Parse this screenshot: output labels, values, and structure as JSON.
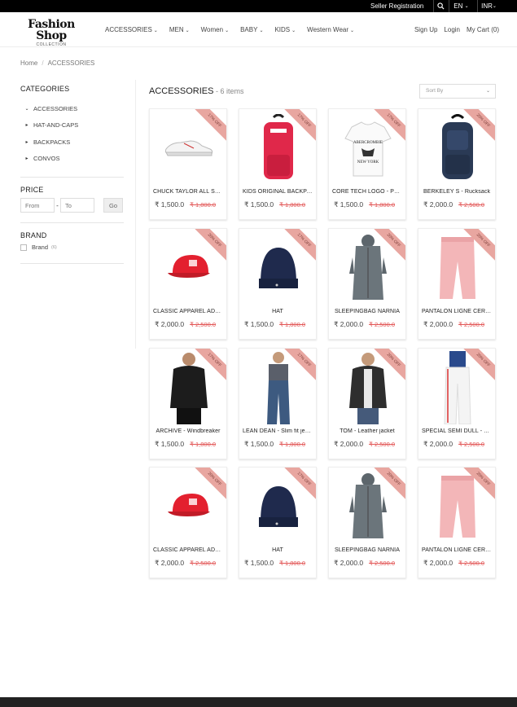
{
  "topbar": {
    "seller": "Seller Registration",
    "lang": "EN",
    "currency": "INR"
  },
  "logo": {
    "line1": "Fashion Shop",
    "line2": "COLLECTION"
  },
  "nav": [
    {
      "label": "ACCESSORIES"
    },
    {
      "label": "MEN"
    },
    {
      "label": "Women"
    },
    {
      "label": "BABY"
    },
    {
      "label": "KIDS"
    },
    {
      "label": "Western Wear"
    }
  ],
  "header_right": {
    "signup": "Sign Up",
    "login": "Login",
    "cart": "My Cart (0)"
  },
  "breadcrumb": {
    "home": "Home",
    "sep": "/",
    "current": "ACCESSORIES"
  },
  "sidebar": {
    "categories_title": "CATEGORIES",
    "categories": [
      {
        "label": "ACCESSORIES",
        "arrow": "⌄"
      },
      {
        "label": "HAT-AND-CAPS",
        "arrow": "▸"
      },
      {
        "label": "BACKPACKS",
        "arrow": "▸"
      },
      {
        "label": "CONVOS",
        "arrow": "▸"
      }
    ],
    "price_title": "PRICE",
    "price_from": "From",
    "price_to": "To",
    "go": "Go",
    "brand_title": "BRAND",
    "brand_label": "Brand",
    "brand_count": "(6)"
  },
  "products_title": "ACCESSORIES",
  "products_count": " - 6 items",
  "sort_placeholder": "Sort By",
  "products": [
    {
      "name": "CHUCK TAYLOR ALL STAR",
      "price": "₹ 1,500.0",
      "old": "₹ 1,800.0",
      "badge": "17% OFF",
      "icon": "sneaker"
    },
    {
      "name": "KIDS ORIGINAL BACKPACK",
      "price": "₹ 1,500.0",
      "old": "₹ 1,800.0",
      "badge": "17% OFF",
      "icon": "backpack-red"
    },
    {
      "name": "CORE TECH LOGO - PRINT",
      "price": "₹ 1,500.0",
      "old": "₹ 1,800.0",
      "badge": "17% OFF",
      "icon": "tshirt"
    },
    {
      "name": "BERKELEY S - Rucksack",
      "price": "₹ 2,000.0",
      "old": "₹ 2,500.0",
      "badge": "20% OFF",
      "icon": "backpack-navy"
    },
    {
      "name": "CLASSIC APPAREL ADJUSTABLE",
      "price": "₹ 2,000.0",
      "old": "₹ 2,500.0",
      "badge": "20% OFF",
      "icon": "cap"
    },
    {
      "name": "HAT",
      "price": "₹ 1,500.0",
      "old": "₹ 1,800.0",
      "badge": "17% OFF",
      "icon": "beanie"
    },
    {
      "name": "SLEEPINGBAG NARNIA",
      "price": "₹ 2,000.0",
      "old": "₹ 2,500.0",
      "badge": "20% OFF",
      "icon": "sleepingbag"
    },
    {
      "name": "PANTALON LIGNE CEREMONIE",
      "price": "₹ 2,000.0",
      "old": "₹ 2,500.0",
      "badge": "20% OFF",
      "icon": "pants-pink"
    },
    {
      "name": "ARCHIVE - Windbreaker",
      "price": "₹ 1,500.0",
      "old": "₹ 1,800.0",
      "badge": "17% OFF",
      "icon": "man-black"
    },
    {
      "name": "LEAN DEAN - Slim fit jeans",
      "price": "₹ 1,500.0",
      "old": "₹ 1,800.0",
      "badge": "17% OFF",
      "icon": "jeans"
    },
    {
      "name": "TOM - Leather jacket",
      "price": "₹ 2,000.0",
      "old": "₹ 2,500.0",
      "badge": "20% OFF",
      "icon": "man-jacket"
    },
    {
      "name": "SPECIAL SEMI DULL - Tracksuit",
      "price": "₹ 2,000.0",
      "old": "₹ 2,500.0",
      "badge": "20% OFF",
      "icon": "man-white"
    },
    {
      "name": "CLASSIC APPAREL ADJUSTABLE",
      "price": "₹ 2,000.0",
      "old": "₹ 2,500.0",
      "badge": "20% OFF",
      "icon": "cap"
    },
    {
      "name": "HAT",
      "price": "₹ 1,500.0",
      "old": "₹ 1,800.0",
      "badge": "17% OFF",
      "icon": "beanie"
    },
    {
      "name": "SLEEPINGBAG NARNIA",
      "price": "₹ 2,000.0",
      "old": "₹ 2,500.0",
      "badge": "20% OFF",
      "icon": "sleepingbag"
    },
    {
      "name": "PANTALON LIGNE CEREMONIE",
      "price": "₹ 2,000.0",
      "old": "₹ 2,500.0",
      "badge": "20% OFF",
      "icon": "pants-pink"
    }
  ],
  "colors": {
    "accent": "#e25555",
    "ribbon": "#e8a6a0",
    "topbar": "#000000"
  }
}
